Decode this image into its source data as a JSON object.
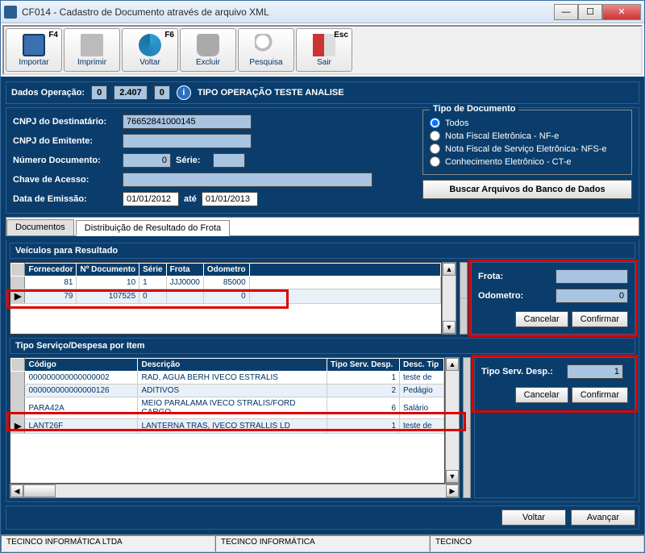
{
  "window": {
    "title": "CF014 - Cadastro de Documento através de arquivo XML"
  },
  "toolbar": [
    {
      "label": "Importar",
      "shortcut": "F4",
      "icon": "save-icon"
    },
    {
      "label": "Imprimir",
      "shortcut": "",
      "icon": "print-icon"
    },
    {
      "label": "Voltar",
      "shortcut": "F6",
      "icon": "back-icon"
    },
    {
      "label": "Excluir",
      "shortcut": "",
      "icon": "delete-icon"
    },
    {
      "label": "Pesquisa",
      "shortcut": "",
      "icon": "search-icon"
    },
    {
      "label": "Sair",
      "shortcut": "Esc",
      "icon": "exit-icon"
    }
  ],
  "dadosOperacao": {
    "label": "Dados Operação:",
    "seg1": "0",
    "seg2": "2.407",
    "seg3": "0",
    "desc": "TIPO OPERAÇÃO TESTE ANALISE"
  },
  "filtros": {
    "cnpjDestLabel": "CNPJ do Destinatário:",
    "cnpjDest": "76652841000145",
    "cnpjEmitLabel": "CNPJ do Emitente:",
    "cnpjEmit": "",
    "numDocLabel": "Número Documento:",
    "numDoc": "0",
    "serieLabel": "Série:",
    "serie": "",
    "chaveLabel": "Chave de Acesso:",
    "chave": "",
    "dataEmLabel": "Data de Emissão:",
    "dataIni": "01/01/2012",
    "ate": "até",
    "dataFim": "01/01/2013"
  },
  "tipoDoc": {
    "legend": "Tipo de Documento",
    "opts": [
      "Todos",
      "Nota Fiscal Eletrônica - NF-e",
      "Nota Fiscal de Serviço Eletrônica- NFS-e",
      "Conhecimento Eletrônico - CT-e"
    ],
    "buscar": "Buscar Arquivos do Banco de Dados"
  },
  "tabs": {
    "documentos": "Documentos",
    "dist": "Distribuição de Resultado do Frota"
  },
  "veiculos": {
    "title": "Veículos para Resultado",
    "headers": [
      "Fornecedor",
      "Nº Documento",
      "Série",
      "Frota",
      "Odometro"
    ],
    "rows": [
      {
        "forn": "81",
        "doc": "10",
        "serie": "1",
        "frota": "JJJ0000",
        "odo": "85000"
      },
      {
        "forn": "79",
        "doc": "107525",
        "serie": "0",
        "frota": "",
        "odo": "0"
      }
    ]
  },
  "frotaPanel": {
    "frotaLabel": "Frota:",
    "frota": "",
    "odoLabel": "Odometro:",
    "odo": "0",
    "cancelar": "Cancelar",
    "confirmar": "Confirmar"
  },
  "tipoServ": {
    "title": "Tipo Serviço/Despesa  por Item",
    "headers": [
      "Código",
      "Descrição",
      "Tipo Serv. Desp.",
      "Desc. Tip"
    ],
    "rows": [
      {
        "cod": "000000000000000002",
        "desc": "RAD, AGUA BERH IVECO ESTRALIS",
        "tipo": "1",
        "desctip": "teste de"
      },
      {
        "cod": "000000000000000126",
        "desc": "ADITIVOS",
        "tipo": "2",
        "desctip": "Pedágio"
      },
      {
        "cod": "PARA42A",
        "desc": "MEIO PARALAMA IVECO STRALIS/FORD CARGO",
        "tipo": "6",
        "desctip": "Salário"
      },
      {
        "cod": "LANT26F",
        "desc": "LANTERNA TRAS, IVECO STRALLIS LD",
        "tipo": "1",
        "desctip": "teste de"
      }
    ]
  },
  "servPanel": {
    "label": "Tipo Serv. Desp.:",
    "value": "1",
    "cancelar": "Cancelar",
    "confirmar": "Confirmar"
  },
  "bottom": {
    "voltar": "Voltar",
    "avancar": "Avançar"
  },
  "status": {
    "cell1": "TECINCO INFORMÁTICA LTDA",
    "cell2": "TECINCO INFORMÁTICA",
    "cell3": "TECINCO"
  }
}
